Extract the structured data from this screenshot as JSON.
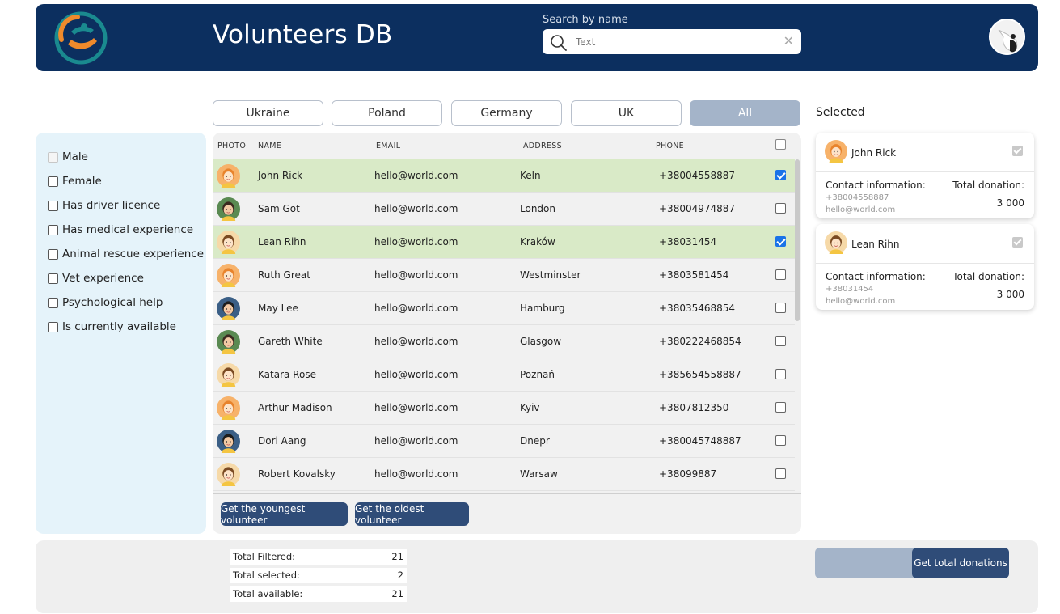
{
  "header": {
    "title": "Volunteers DB",
    "search_label": "Search by name",
    "search_placeholder": "Text",
    "search_value": "",
    "logo_icon": "helping-hands-icon",
    "clear_icon": "close-icon",
    "colors": {
      "header_bg": "#0c2f5f",
      "logo_orange": "#f08a2b",
      "logo_teal": "#1a8a8f"
    }
  },
  "tabs": [
    {
      "label": "Ukraine",
      "active": false
    },
    {
      "label": "Poland",
      "active": false
    },
    {
      "label": "Germany",
      "active": false
    },
    {
      "label": "UK",
      "active": false
    },
    {
      "label": "All",
      "active": true
    }
  ],
  "filters": [
    {
      "label": "Male",
      "checked": false,
      "disabled": true
    },
    {
      "label": "Female",
      "checked": false,
      "disabled": false
    },
    {
      "label": "Has driver licence",
      "checked": false,
      "disabled": false
    },
    {
      "label": "Has medical experience",
      "checked": false,
      "disabled": false
    },
    {
      "label": "Animal rescue experience",
      "checked": false,
      "disabled": false
    },
    {
      "label": "Vet experience",
      "checked": false,
      "disabled": false
    },
    {
      "label": "Psychological help",
      "checked": false,
      "disabled": false
    },
    {
      "label": "Is currently available",
      "checked": false,
      "disabled": false
    }
  ],
  "table": {
    "columns": [
      "PHOTO",
      "NAME",
      "EMAIL",
      "ADDRESS",
      "PHONE"
    ],
    "rows": [
      {
        "name": "John Rick",
        "email": "hello@world.com",
        "address": "Keln",
        "phone": "+38004558887",
        "selected": true,
        "avatar": "boy-orange"
      },
      {
        "name": "Sam Got",
        "email": "hello@world.com",
        "address": "London",
        "phone": "+38004974887",
        "selected": false,
        "avatar": "man-green"
      },
      {
        "name": "Lean Rihn",
        "email": "hello@world.com",
        "address": "Kraków",
        "phone": "+38031454",
        "selected": true,
        "avatar": "girl-brown"
      },
      {
        "name": "Ruth Great",
        "email": "hello@world.com",
        "address": "Westminster",
        "phone": "+3803581454",
        "selected": false,
        "avatar": "boy-orange"
      },
      {
        "name": "May Lee",
        "email": "hello@world.com",
        "address": "Hamburg",
        "phone": "+38035468854",
        "selected": false,
        "avatar": "woman-blue"
      },
      {
        "name": "Gareth White",
        "email": "hello@world.com",
        "address": "Glasgow",
        "phone": "+380222468854",
        "selected": false,
        "avatar": "man-green"
      },
      {
        "name": "Katara Rose",
        "email": "hello@world.com",
        "address": "Poznań",
        "phone": "+385654558887",
        "selected": false,
        "avatar": "girl-brown"
      },
      {
        "name": "Arthur Madison",
        "email": "hello@world.com",
        "address": "Kyiv",
        "phone": "+3807812350",
        "selected": false,
        "avatar": "boy-orange"
      },
      {
        "name": "Dori Aang",
        "email": "hello@world.com",
        "address": "Dnepr",
        "phone": "+380045748887",
        "selected": false,
        "avatar": "woman-blue"
      },
      {
        "name": "Robert Kovalsky",
        "email": "hello@world.com",
        "address": "Warsaw",
        "phone": "+38099887",
        "selected": false,
        "avatar": "girl-brown"
      }
    ],
    "buttons": {
      "youngest": "Get the youngest volunteer",
      "oldest": "Get the oldest volunteer"
    }
  },
  "selected_panel": {
    "title": "Selected",
    "contact_label": "Contact information:",
    "donation_label": "Total donation:",
    "cards": [
      {
        "name": "John Rick",
        "phone": "+38004558887",
        "email": "hello@world.com",
        "donation": "3 000",
        "avatar": "boy-orange"
      },
      {
        "name": "Lean Rihn",
        "phone": "+38031454",
        "email": "hello@world.com",
        "donation": "3 000",
        "avatar": "girl-brown"
      }
    ]
  },
  "stats": [
    {
      "label": "Total Filtered:",
      "value": "21"
    },
    {
      "label": "Total selected:",
      "value": "2"
    },
    {
      "label": "Total available:",
      "value": "21"
    }
  ],
  "donations_button": "Get total donations",
  "avatar_colors": {
    "boy-orange": {
      "bg": "#f7b26a",
      "hair": "#e8832c",
      "skin": "#fde3c8"
    },
    "man-green": {
      "bg": "#5a8a52",
      "hair": "#3b2a1f",
      "skin": "#f2c9a4"
    },
    "girl-brown": {
      "bg": "#f6d9a8",
      "hair": "#7a4a22",
      "skin": "#fde3c8"
    },
    "woman-blue": {
      "bg": "#3b5f86",
      "hair": "#1d1d1d",
      "skin": "#f2c9a4"
    }
  }
}
